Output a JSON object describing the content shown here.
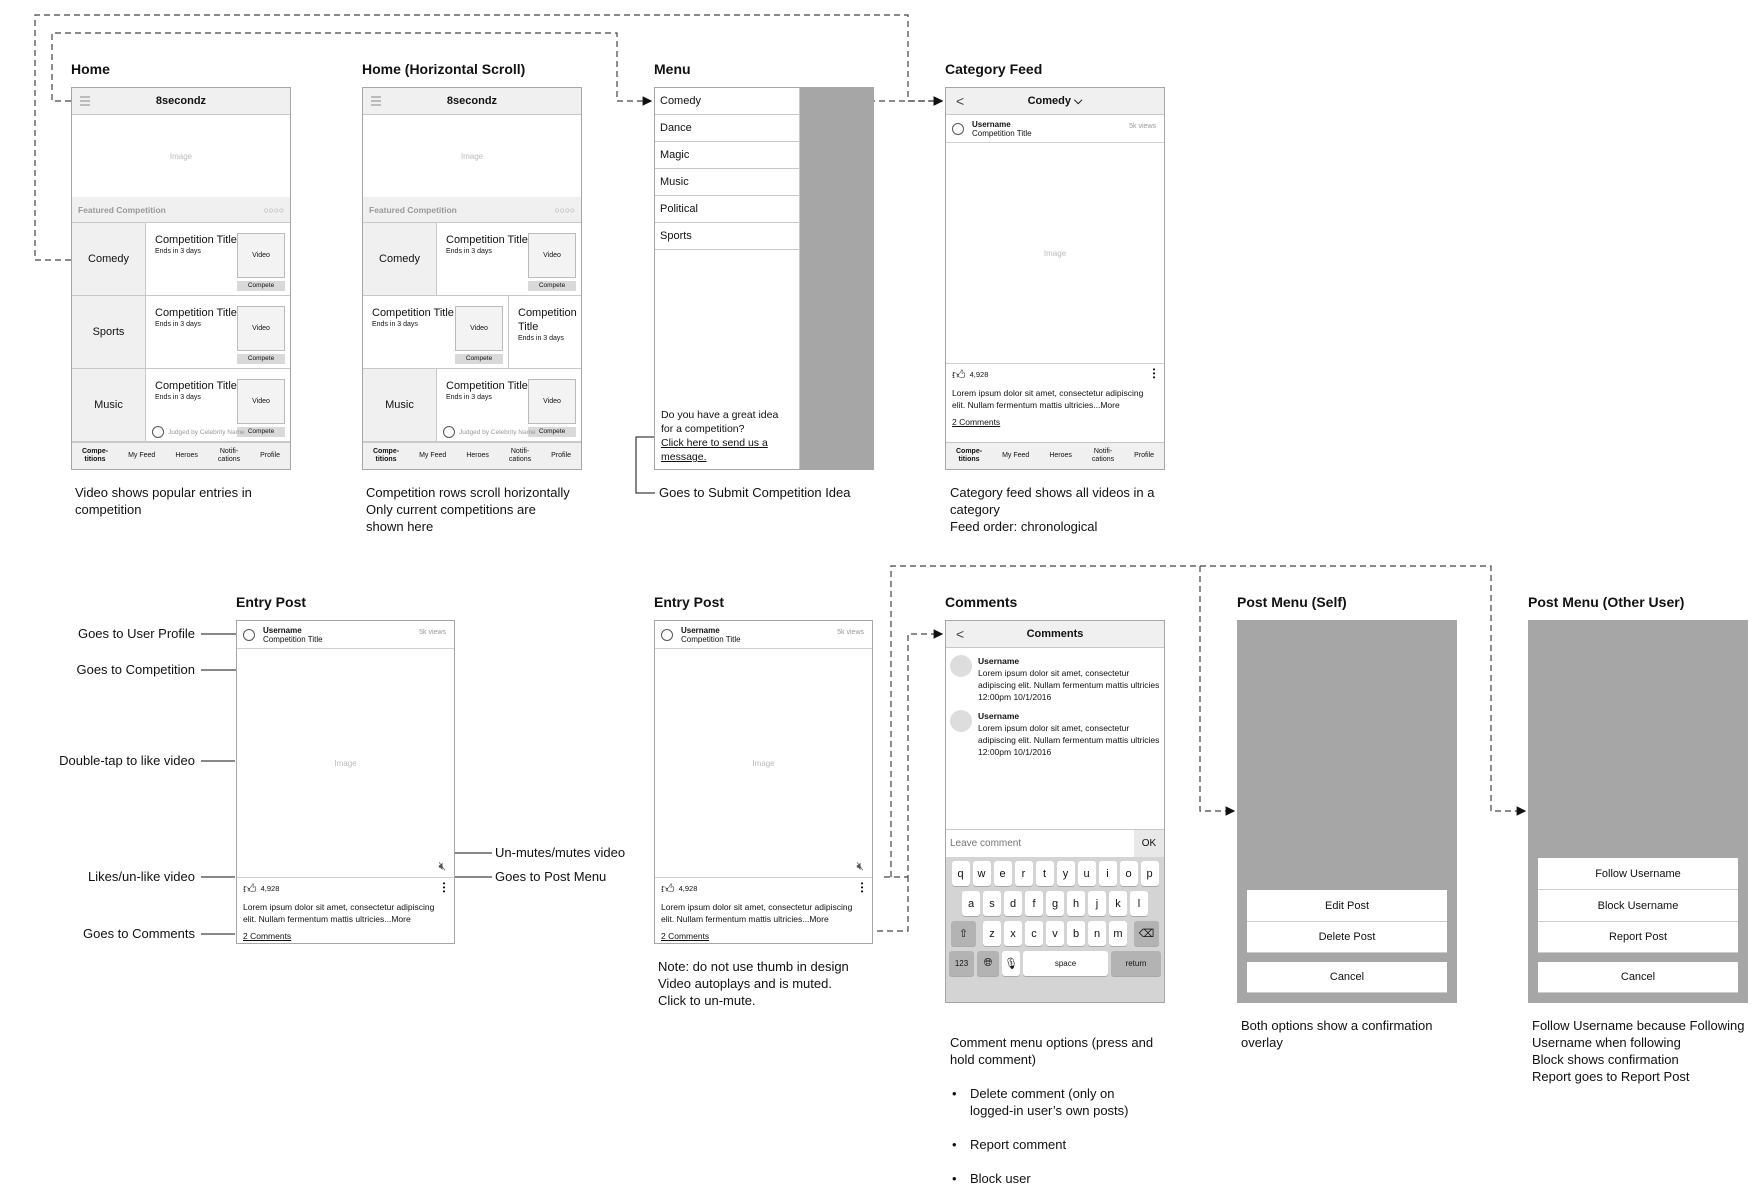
{
  "screens": {
    "home": {
      "title": "Home",
      "app_name": "8secondz",
      "image_label": "Image",
      "featured_label": "Featured Competition",
      "pager_dots": "○○○○",
      "rows": [
        {
          "category": "Comedy",
          "comp_title": "Competition Title",
          "ends": "Ends in 3 days",
          "video": "Video",
          "compete": "Compete"
        },
        {
          "category": "Sports",
          "comp_title": "Competition Title",
          "ends": "Ends in 3 days",
          "video": "Video",
          "compete": "Compete"
        },
        {
          "category": "Music",
          "comp_title": "Competition Title",
          "ends": "Ends in 3 days",
          "video": "Video",
          "compete": "Compete",
          "judge": "Judged by Celebrity Name"
        }
      ],
      "note": "Video shows popular entries in\ncompetition"
    },
    "home_h": {
      "title": "Home (Horizontal Scroll)",
      "note": "Competition rows scroll horizontally\nOnly current competitions are\nshown here"
    },
    "tabs": [
      "Compe-\ntitions",
      "My Feed",
      "Heroes",
      "Notifi-\ncations",
      "Profile"
    ],
    "menu": {
      "title": "Menu",
      "items": [
        "Comedy",
        "Dance",
        "Magic",
        "Music",
        "Political",
        "Sports"
      ],
      "idea_text": "Do you have a great idea for a competition?",
      "idea_link": "Click here to send us a message.",
      "note": "Goes to Submit Competition Idea"
    },
    "category_feed": {
      "title": "Category Feed",
      "header": "Comedy ⌵",
      "note": "Category feed shows all videos in a\ncategory\nFeed order: chronological"
    },
    "post": {
      "username": "Username",
      "comp_title": "Competition Title",
      "views": "5k views",
      "image_label": "Image",
      "likes": "4,928",
      "caption": "Lorem ipsum dolor sit amet, consectetur adipiscing elit. Nullam fermentum mattis ultricies...More",
      "comments_link": "2 Comments"
    },
    "entry_post_1": {
      "title": "Entry Post",
      "callouts": {
        "profile": "Goes to User Profile",
        "competition": "Goes to Competition",
        "double_tap": "Double-tap to like video",
        "like": "Likes/un-like video",
        "comments": "Goes to Comments",
        "mute": "Un-mutes/mutes video",
        "post_menu": "Goes to Post Menu"
      }
    },
    "entry_post_2": {
      "title": "Entry Post",
      "note": "Note: do not use thumb in design\nVideo autoplays and  is muted.\nClick to un-mute."
    },
    "comments": {
      "title": "Comments",
      "header": "Comments",
      "items": [
        {
          "user": "Username",
          "text": "Lorem ipsum dolor sit amet, consectetur adipiscing elit. Nullam fermentum mattis ultricies",
          "time": "12:00pm 10/1/2016"
        },
        {
          "user": "Username",
          "text": "Lorem ipsum dolor sit amet, consectetur adipiscing elit. Nullam fermentum mattis ultricies",
          "time": "12:00pm 10/1/2016"
        }
      ],
      "input_placeholder": "Leave comment",
      "ok": "OK",
      "keys_row1": [
        "q",
        "w",
        "e",
        "r",
        "t",
        "y",
        "u",
        "i",
        "o",
        "p"
      ],
      "keys_row2": [
        "a",
        "s",
        "d",
        "f",
        "g",
        "h",
        "j",
        "k",
        "l"
      ],
      "keys_row3": [
        "z",
        "x",
        "c",
        "v",
        "b",
        "n",
        "m"
      ],
      "key_123": "123",
      "key_space": "space",
      "key_return": "return",
      "note": "Comment menu options (press and\nhold comment)",
      "bullets": [
        "Delete comment (only on\nlogged-in user’s own posts)",
        "Report comment",
        "Block user"
      ]
    },
    "post_menu_self": {
      "title": "Post Menu (Self)",
      "options": [
        "Edit Post",
        "Delete Post"
      ],
      "cancel": "Cancel",
      "note": "Both options show a confirmation\noverlay"
    },
    "post_menu_other": {
      "title": "Post Menu (Other User)",
      "options": [
        "Follow Username",
        "Block Username",
        "Report Post"
      ],
      "cancel": "Cancel",
      "note": "Follow Username because Following\nUsername when following\nBlock shows confirmation\nReport goes to Report Post"
    }
  }
}
